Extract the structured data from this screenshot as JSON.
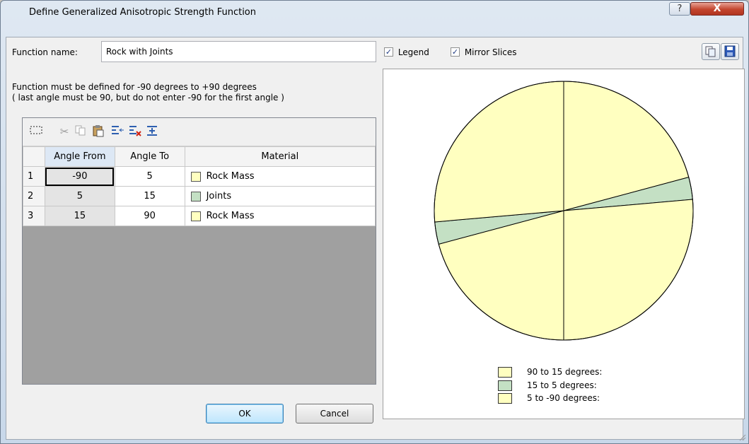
{
  "window": {
    "title": "Define Generalized Anisotropic Strength Function",
    "help_glyph": "?",
    "close_glyph": "X"
  },
  "function_name": {
    "label": "Function name:",
    "value": "Rock with Joints"
  },
  "options": {
    "legend_label": "Legend",
    "legend_checked": true,
    "mirror_label": "Mirror Slices",
    "mirror_checked": true
  },
  "info": {
    "line1": "Function must be defined for -90 degrees to +90 degrees",
    "line2": "( last angle must be 90, but do not enter -90 for the first angle )"
  },
  "grid": {
    "toolbar_icons": [
      "select-all-icon",
      "cut-icon",
      "copy-icon",
      "paste-icon",
      "insert-row-icon",
      "delete-row-icon",
      "append-row-icon"
    ],
    "headers": {
      "angle_from": "Angle From",
      "angle_to": "Angle To",
      "material": "Material"
    },
    "rows": [
      {
        "num": "1",
        "from": "-90",
        "to": "5",
        "material": "Rock Mass",
        "color": "#ffffc0"
      },
      {
        "num": "2",
        "from": "5",
        "to": "15",
        "material": "Joints",
        "color": "#c4e0c4"
      },
      {
        "num": "3",
        "from": "15",
        "to": "90",
        "material": "Rock Mass",
        "color": "#ffffc0"
      }
    ]
  },
  "buttons": {
    "ok": "OK",
    "cancel": "Cancel"
  },
  "chart_data": {
    "type": "pie",
    "mirror_slices": true,
    "slices": [
      {
        "label": "90 to 15 degrees:",
        "from": 90,
        "to": 15,
        "color": "#ffffc0"
      },
      {
        "label": "15 to 5 degrees:",
        "from": 15,
        "to": 5,
        "color": "#c4e0c4"
      },
      {
        "label": "5 to -90 degrees:",
        "from": 5,
        "to": -90,
        "color": "#ffffc0"
      }
    ],
    "legend_position": "bottom"
  }
}
